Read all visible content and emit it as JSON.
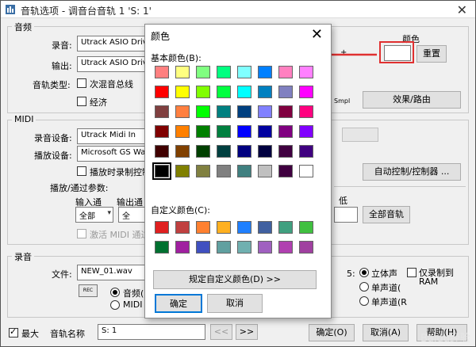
{
  "window": {
    "title": "音轨选项 - 调音台音轨 1 'S: 1'",
    "close_icon": "close-icon"
  },
  "audio": {
    "group_title": "音频",
    "record_label": "录音:",
    "record_value": "Utrack ASIO Driver",
    "output_label": "输出:",
    "output_value": "Utrack ASIO Driver",
    "track_type_label": "音轨类型:",
    "submix_bus_label": "次混音总线",
    "economy_label": "经济",
    "plus_label": "+",
    "smpl_label": "Smpl",
    "effects_routing_button": "效果/路由",
    "color_label": "颜色",
    "reset_button": "重置"
  },
  "midi": {
    "group_title": "MIDI",
    "record_device_label": "录音设备:",
    "record_device_value": "Utrack Midi In",
    "playback_device_label": "播放设备:",
    "playback_device_value": "Microsoft GS Wavet",
    "record_on_playback_label": "播放时录制控制",
    "auto_control_button": "自动控制/控制器 ...",
    "playback_params_label": "播放/通过参数:",
    "input_channel_label": "输入通",
    "output_channel_label": "输出通",
    "input_channel_value": "全部",
    "output_channel_value": "全",
    "low_label": "低",
    "all_tracks_button": "全部音轨",
    "activate_midi_label": "激活 MIDI 通过"
  },
  "recording": {
    "group_title": "录音",
    "file_label": "文件:",
    "file_value": "NEW_01.wav",
    "rec_label": "REC",
    "audio_radio_label": "音频(U",
    "midi_radio_label": "MIDI",
    "stereo_label": "立体声",
    "mono1_label": "单声道(",
    "mono2_label": "单声道(R",
    "ram_only_label": "仅录制到 RAM",
    "ram_only_line1": "仅录制到",
    "ram_only_line2": "RAM",
    "colon_label": "5:"
  },
  "footer": {
    "maximize_label": "最大",
    "track_name_label": "音轨名称",
    "track_name_value": "S: 1",
    "prev_button": "<<",
    "next_button": ">>",
    "ok_button": "确定(O)",
    "cancel_button": "取消(A)",
    "help_button": "帮助(H)"
  },
  "color_dialog": {
    "title": "颜色",
    "basic_colors_label": "基本颜色(B):",
    "custom_colors_label": "自定义颜色(C):",
    "define_custom_button": "规定自定义颜色(D) >>",
    "ok_button": "确定",
    "cancel_button": "取消",
    "basic_colors": [
      [
        "#ff8080",
        "#ffff80",
        "#80ff80",
        "#00ff80",
        "#80ffff",
        "#0080ff",
        "#ff80c0",
        "#ff80ff"
      ],
      [
        "#ff0000",
        "#ffff00",
        "#80ff00",
        "#00ff40",
        "#00ffff",
        "#0080c0",
        "#8080c0",
        "#ff00ff"
      ],
      [
        "#804040",
        "#ff8040",
        "#00ff00",
        "#008080",
        "#004080",
        "#8080ff",
        "#800040",
        "#ff0080"
      ],
      [
        "#800000",
        "#ff8000",
        "#008000",
        "#008040",
        "#0000ff",
        "#0000a0",
        "#800080",
        "#8000ff"
      ],
      [
        "#400000",
        "#804000",
        "#004000",
        "#004040",
        "#000080",
        "#000040",
        "#400040",
        "#400080"
      ],
      [
        "#000000",
        "#808000",
        "#808040",
        "#808080",
        "#408080",
        "#c0c0c0",
        "#400040",
        "#ffffff"
      ]
    ],
    "custom_colors": [
      [
        "#e02020",
        "#c04040",
        "#ff8030",
        "#ffb020",
        "#2080ff",
        "#4060a0",
        "#40a080",
        "#40c040"
      ],
      [
        "#007030",
        "#a020a0",
        "#4050c0",
        "#60a0a0",
        "#70b0b0",
        "#a060c0",
        "#b040b0",
        "#a040a0"
      ]
    ],
    "accent_color": "#e03030"
  },
  "watermark": "Baidu经验"
}
